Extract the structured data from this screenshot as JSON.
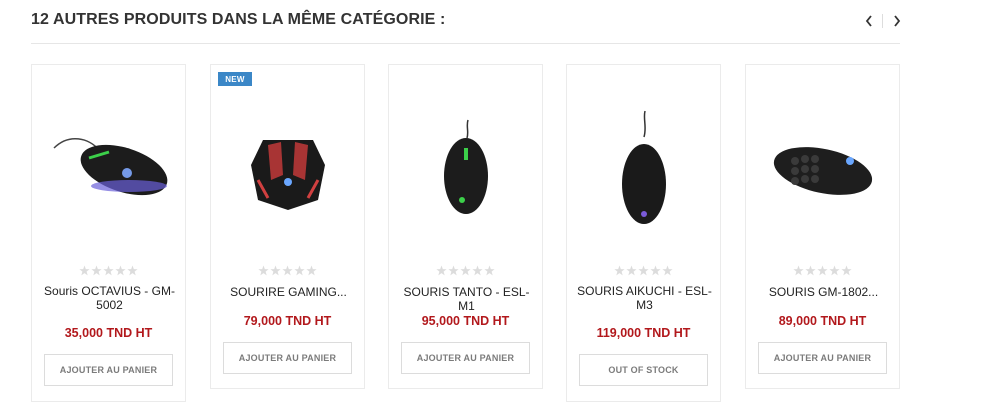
{
  "section": {
    "title": "12 AUTRES PRODUITS DANS LA MÊME CATÉGORIE :",
    "prev_icon": "chevron-left-icon",
    "next_icon": "chevron-right-icon"
  },
  "products": [
    {
      "name": "Souris OCTAVIUS - GM-5002",
      "price": "35,000 TND HT",
      "button": "AJOUTER AU PANIER",
      "rating": 0,
      "badge": ""
    },
    {
      "name": "SOURIRE GAMING...",
      "price": "79,000 TND HT",
      "button": "AJOUTER AU PANIER",
      "rating": 0,
      "badge": "NEW"
    },
    {
      "name": "SOURIS TANTO - ESL-M1",
      "price": "95,000 TND HT",
      "button": "AJOUTER AU PANIER",
      "rating": 0,
      "badge": ""
    },
    {
      "name": "SOURIS AIKUCHI - ESL-M3",
      "price": "119,000 TND HT",
      "button": "OUT OF STOCK",
      "rating": 0,
      "badge": ""
    },
    {
      "name": "SOURIS GM-1802...",
      "price": "89,000 TND HT",
      "button": "AJOUTER AU PANIER",
      "rating": 0,
      "badge": ""
    }
  ],
  "colors": {
    "price": "#b2181c",
    "badge": "#3b87c7",
    "border": "#ebebeb"
  }
}
